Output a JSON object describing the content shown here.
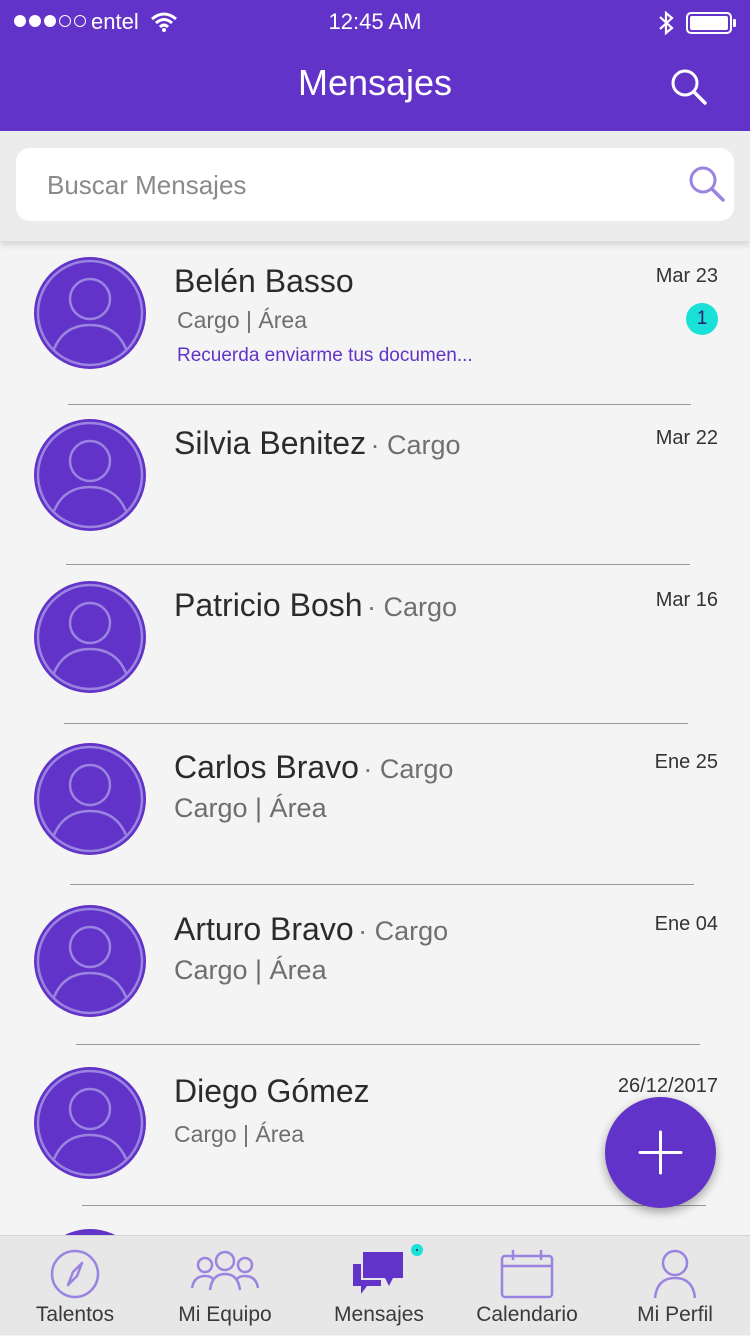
{
  "status_bar": {
    "carrier": "entel",
    "time": "12:45 AM",
    "signal_dots_filled": 3,
    "signal_dots_total": 5
  },
  "header": {
    "title": "Mensajes",
    "search_icon": "search-icon"
  },
  "search": {
    "placeholder": "Buscar Mensajes",
    "value": "",
    "icon": "search-icon"
  },
  "messages": [
    {
      "name": "Belén Basso",
      "cargo": "",
      "subtitle": "Cargo | Área",
      "preview": "Recuerda enviarme tus documen...",
      "date": "Mar 23",
      "unread": "1"
    },
    {
      "name": "Silvia Benitez",
      "cargo": "· Cargo",
      "subtitle": "",
      "preview": "",
      "date": "Mar 22",
      "unread": ""
    },
    {
      "name": "Patricio Bosh",
      "cargo": "· Cargo",
      "subtitle": "",
      "preview": "",
      "date": "Mar 16",
      "unread": ""
    },
    {
      "name": "Carlos Bravo",
      "cargo": "· Cargo",
      "subtitle": "Cargo | Área",
      "preview": "",
      "date": "Ene 25",
      "unread": ""
    },
    {
      "name": "Arturo Bravo",
      "cargo": "· Cargo",
      "subtitle": "Cargo | Área",
      "preview": "",
      "date": "Ene 04",
      "unread": ""
    },
    {
      "name": "Diego Gómez",
      "cargo": "",
      "subtitle": "Cargo | Área",
      "preview": "",
      "date": "26/12/2017",
      "unread": ""
    }
  ],
  "fab": {
    "icon": "plus-icon"
  },
  "tabs": [
    {
      "label": "Talentos",
      "icon": "compass-icon",
      "active": false
    },
    {
      "label": "Mi Equipo",
      "icon": "team-icon",
      "active": false
    },
    {
      "label": "Mensajes",
      "icon": "chat-icon",
      "active": true,
      "has_notification": true
    },
    {
      "label": "Calendario",
      "icon": "calendar-icon",
      "active": false
    },
    {
      "label": "Mi Perfil",
      "icon": "profile-icon",
      "active": false
    }
  ],
  "colors": {
    "brand_purple": "#6233c8",
    "badge_cyan": "#19e1d8",
    "icon_light_purple": "#9a84e0",
    "background": "#f4f4f4"
  }
}
